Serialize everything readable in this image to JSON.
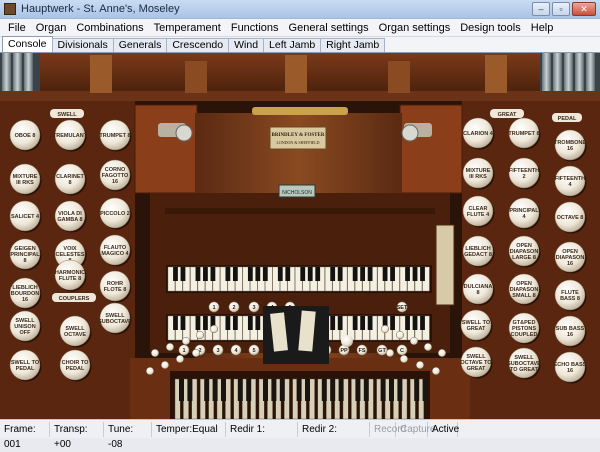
{
  "window": {
    "title": "Hauptwerk - St. Anne's, Moseley",
    "minimize": "–",
    "maximize": "▫",
    "close": "✕"
  },
  "menu": [
    "File",
    "Organ",
    "Combinations",
    "Temperament",
    "Functions",
    "General settings",
    "Organ settings",
    "Design tools",
    "Help"
  ],
  "tabs": [
    "Console",
    "Divisionals",
    "Generals",
    "Crescendo",
    "Wind",
    "Left Jamb",
    "Right Jamb"
  ],
  "active_tab": "Console",
  "console": {
    "nameplate_line1": "BRINDLEY & FOSTER",
    "nameplate_line2": "LONDON & SHEFFIELD",
    "small_plate": "NICHOLSON",
    "left_jamb": {
      "header_swell": "SWELL",
      "header_couplers": "COUPLERS",
      "stops": [
        "OBOE 8",
        "TREMULANT",
        "TRUMPET 8",
        "MIXTURE III RKS",
        "CLARINET 8",
        "CORNO FAGOTTO 16",
        "SALICET 4",
        "VIOLA DI GAMBA 8",
        "PICCOLO 2",
        "GEIGEN PRINCIPAL 8",
        "VOIX CELESTES 8",
        "FLAUTO MAGICO 4",
        "LIEBLICH BOURDON 16",
        "HARMONIC FLUTE 8",
        "ROHR FLOTE 8",
        "SWELL UNISON OFF",
        "SWELL OCTAVE",
        "SWELL SUBOCTAVE",
        "SWELL TO PEDAL",
        "CHOIR TO PEDAL"
      ]
    },
    "right_jamb": {
      "header_great": "GREAT",
      "header_pedal": "PEDAL",
      "stops": [
        "CLARION 4",
        "TRUMPET 8",
        "TROMBONE 16",
        "MIXTURE III RKS",
        "FIFTEENTH 2",
        "FIFTEENTH 4",
        "CLEAR FLUTE 4",
        "PRINCIPAL 4",
        "OCTAVE 8",
        "LIEBLICH GEDACT 8",
        "OPEN DIAPASON LARGE 8",
        "OPEN DIAPASON 16",
        "DULCIANA 8",
        "OPEN DIAPASON SMALL 8",
        "FLUTE BASS 8",
        "SWELL TO GREAT",
        "GT&PED PISTONS COUPLED",
        "SUB BASS 16",
        "SWELL OCTAVE TO GREAT",
        "SWELL SUBOCTAVE TO GREAT",
        "ECHO BASS 16"
      ]
    },
    "pistons_upper": [
      "1",
      "2",
      "3",
      "4",
      "5",
      "SET"
    ],
    "pistons_lower": [
      "1",
      "2",
      "3",
      "4",
      "5",
      "FF",
      "PP",
      "FS",
      "GT",
      "C"
    ]
  },
  "status": {
    "frame": "Frame: 001",
    "transp": "Transp: +00",
    "tune": "Tune: -08",
    "temper": "Temper:Equal",
    "redir1": "Redir 1:",
    "redir2": "Redir 2:",
    "record": "Record",
    "capture": "Capture",
    "active": "Active"
  }
}
